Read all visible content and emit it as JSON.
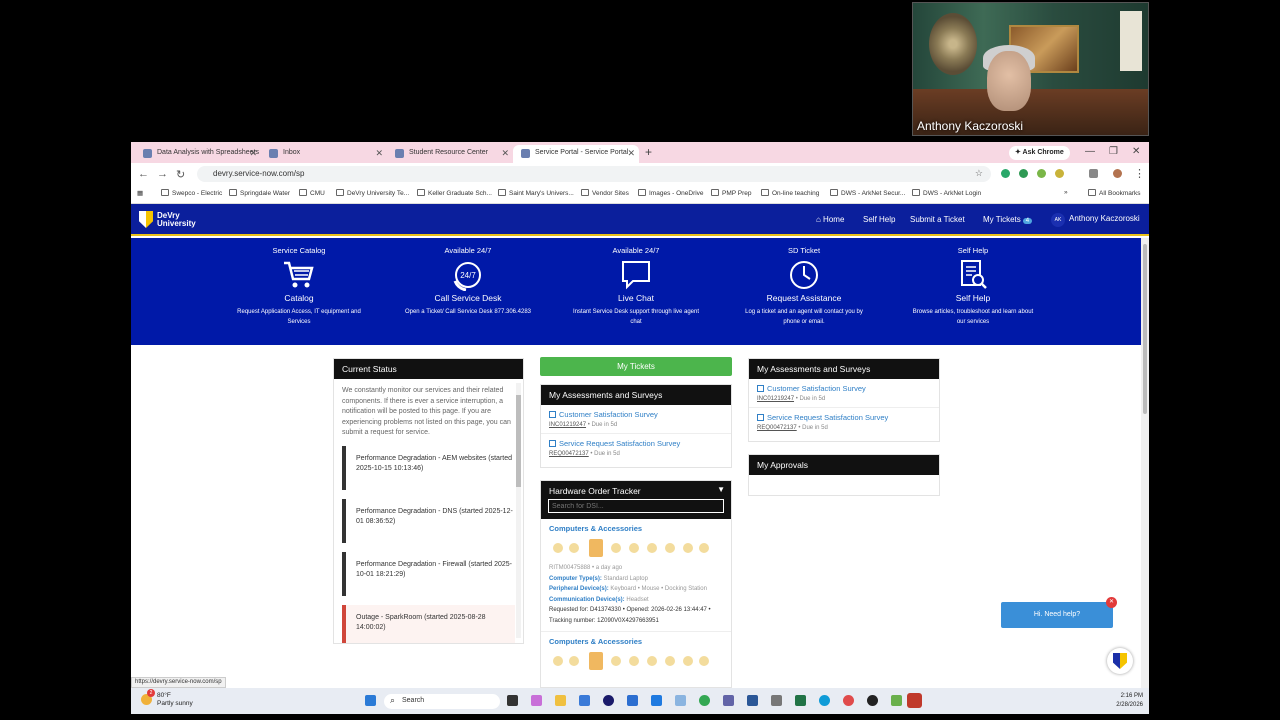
{
  "webcam": {
    "name": "Anthony Kaczoroski"
  },
  "browser": {
    "tabs": [
      {
        "label": "Data Analysis with Spreadsheets",
        "active": false
      },
      {
        "label": "Inbox",
        "active": false
      },
      {
        "label": "Student Resource Center",
        "active": false
      },
      {
        "label": "Service Portal - Service Portal",
        "active": true
      }
    ],
    "ask_chrome": "✦ Ask Chrome",
    "url": "devry.service-now.com/sp",
    "bookmarks": [
      "Swepco - Electric",
      "Springdale Water",
      "CMU",
      "DeVry University Te...",
      "Keller Graduate Sch...",
      "Saint Mary's Univers...",
      "Vendor Sites",
      "Images - OneDrive",
      "PMP Prep",
      "On-line teaching",
      "DWS - ArkNet Secur...",
      "DWS - ArkNet Login"
    ],
    "all_bookmarks": "All Bookmarks",
    "status_url": "https://devry.service-now.com/sp"
  },
  "site": {
    "logo_line1": "DeVry",
    "logo_line2": "University",
    "nav": {
      "home": "⌂ Home",
      "self_help": "Self Help",
      "submit": "Submit a Ticket",
      "my_tickets": "My Tickets",
      "my_tickets_count": "4",
      "user_initials": "AK",
      "user_name": "Anthony Kaczoroski"
    }
  },
  "hero": [
    {
      "top": "Service Catalog",
      "label": "Catalog",
      "desc": "Request Application Access, IT equipment and Services",
      "icon": "cart-icon"
    },
    {
      "top": "Available 24/7",
      "label": "Call Service Desk",
      "desc": "Open a Ticket/ Call Service Desk 877.306.4283",
      "icon": "phone-24-icon"
    },
    {
      "top": "Available 24/7",
      "label": "Live Chat",
      "desc": "Instant Service Desk support through live agent chat",
      "icon": "chat-icon"
    },
    {
      "top": "SD Ticket",
      "label": "Request Assistance",
      "desc": "Log a ticket and an agent will contact you by phone or email.",
      "icon": "clock-icon"
    },
    {
      "top": "Self Help",
      "label": "Self Help",
      "desc": "Browse articles, troubleshoot and learn about our services",
      "icon": "document-search-icon"
    }
  ],
  "current_status": {
    "title": "Current Status",
    "intro": "We constantly monitor our services and their related components. If there is ever a service interruption, a notification will be posted to this page. If you are experiencing problems not listed on this page, you can submit a request for service.",
    "items": [
      {
        "text": "Performance Degradation - AEM websites (started 2025-10-15 10:13:46)",
        "type": "degradation"
      },
      {
        "text": "Performance Degradation - DNS (started 2025-12-01 08:36:52)",
        "type": "degradation"
      },
      {
        "text": "Performance Degradation - Firewall (started 2025-10-01 18:21:29)",
        "type": "degradation"
      },
      {
        "text": "Outage - SparkRoom (started 2025-08-28 14:00:02)",
        "type": "outage"
      }
    ]
  },
  "middle": {
    "my_tickets": "My Tickets",
    "assess_title": "My Assessments and Surveys",
    "surveys": [
      {
        "title": "Customer Satisfaction Survey",
        "ref": "INC01219247",
        "due": " • Due in 5d"
      },
      {
        "title": "Service Request Satisfaction Survey",
        "ref": "REQ00472137",
        "due": " • Due in 5d"
      }
    ],
    "hw_title": "Hardware Order Tracker",
    "hw_placeholder": "Search for DSI...",
    "hw_orders": [
      {
        "category": "Computers & Accessories",
        "ritm": "RITM00475888 • a day ago",
        "computer_label": "Computer Type(s):",
        "computer": " Standard Laptop",
        "peripheral_label": "Peripheral Device(s):",
        "peripheral": " Keyboard • Mouse • Docking Station",
        "comm_label": "Communication Device(s):",
        "comm": " Headset",
        "requested": "Requested for: D41374330 • Opened: 2026-02-26 13:44:47 •",
        "tracking": "Tracking number: 1Z090V0X4297663951"
      },
      {
        "category": "Computers & Accessories"
      }
    ]
  },
  "right": {
    "assess_title": "My Assessments and Surveys",
    "surveys": [
      {
        "title": "Customer Satisfaction Survey",
        "ref": "INC01219247",
        "due": " • Due in 5d"
      },
      {
        "title": "Service Request Satisfaction Survey",
        "ref": "REQ00472137",
        "due": " • Due in 5d"
      }
    ],
    "approvals_title": "My Approvals"
  },
  "help": {
    "label": "Hi. Need help?",
    "badge": "✕"
  },
  "taskbar": {
    "weather_temp": "80°F",
    "weather_desc": "Partly sunny",
    "weather_badge": "2",
    "search": "Search",
    "time": "2:16 PM",
    "date": "2/28/2026"
  }
}
